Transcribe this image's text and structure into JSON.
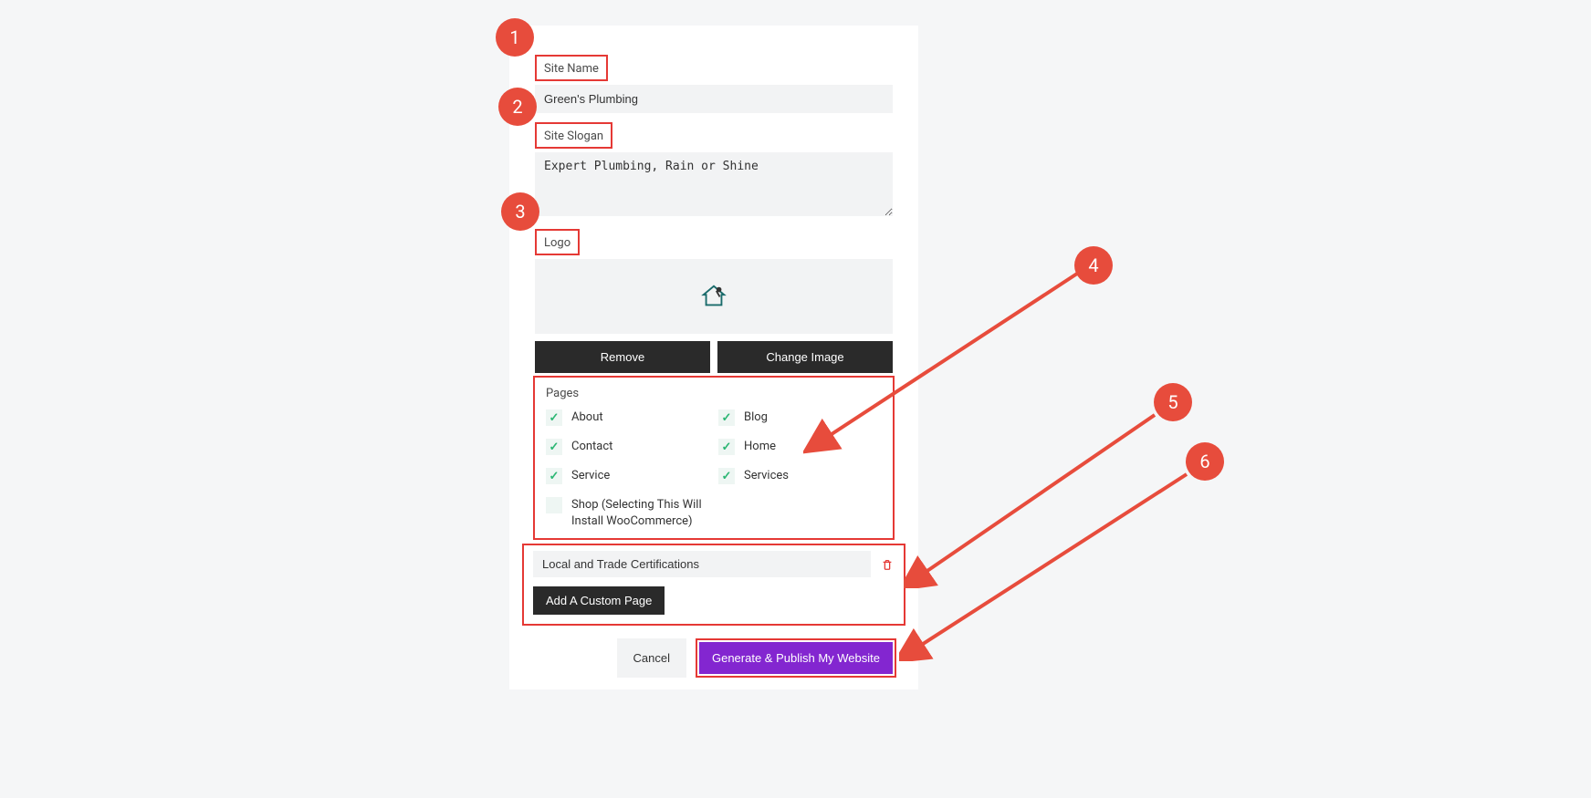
{
  "labels": {
    "site_name": "Site Name",
    "site_slogan": "Site Slogan",
    "logo": "Logo",
    "pages": "Pages"
  },
  "fields": {
    "site_name_value": "Green's Plumbing",
    "site_slogan_value": "Expert Plumbing, Rain or Shine",
    "custom_page_value": "Local and Trade Certifications"
  },
  "buttons": {
    "remove": "Remove",
    "change_image": "Change Image",
    "add_custom_page": "Add A Custom Page",
    "cancel": "Cancel",
    "generate": "Generate & Publish My Website"
  },
  "pages": {
    "about": "About",
    "blog": "Blog",
    "contact": "Contact",
    "home": "Home",
    "service": "Service",
    "services": "Services",
    "shop": "Shop (Selecting This Will Install WooCommerce)"
  },
  "annotations": {
    "a1": "1",
    "a2": "2",
    "a3": "3",
    "a4": "4",
    "a5": "5",
    "a6": "6"
  }
}
